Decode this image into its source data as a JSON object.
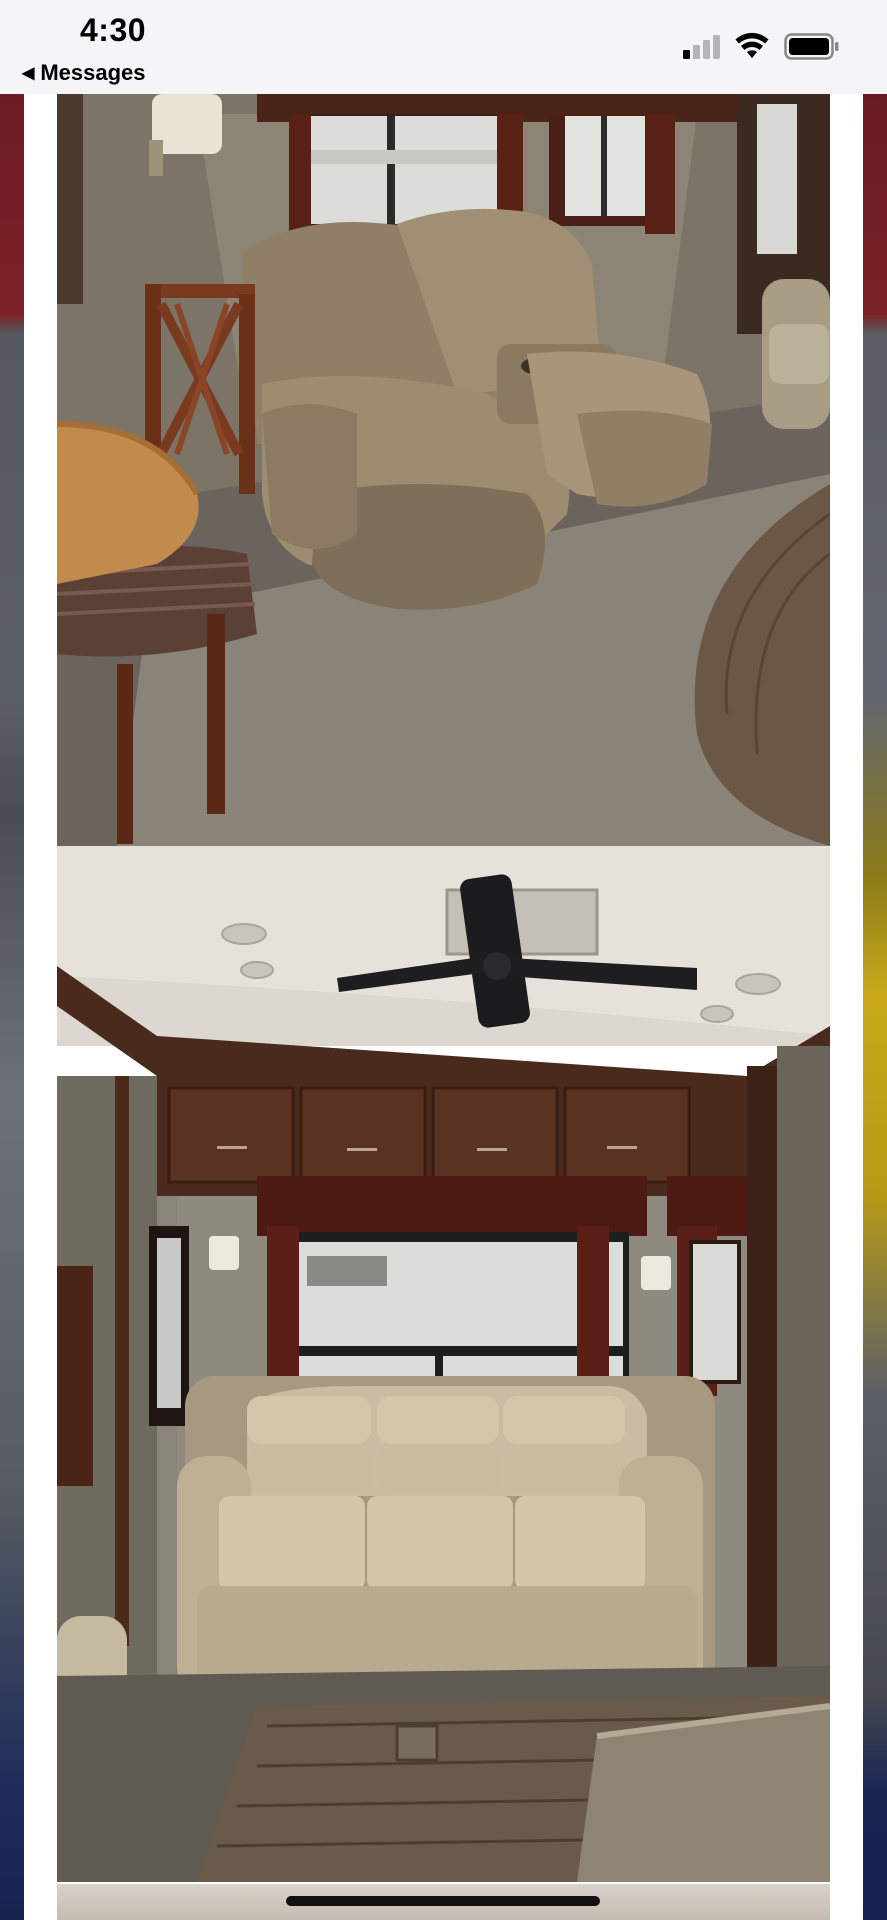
{
  "status_bar": {
    "time": "4:30",
    "back_label": "Messages",
    "icons": [
      "signal-icon",
      "wifi-icon",
      "battery-icon"
    ]
  },
  "viewer": {
    "photos": [
      {
        "name": "recliner-loveseat-photo"
      },
      {
        "name": "living-room-sofa-photo"
      },
      {
        "name": "next-photo-partial"
      }
    ]
  },
  "colors": {
    "status_bar_bg": "#f5f5f7",
    "frame_bg": "#ffffff"
  }
}
